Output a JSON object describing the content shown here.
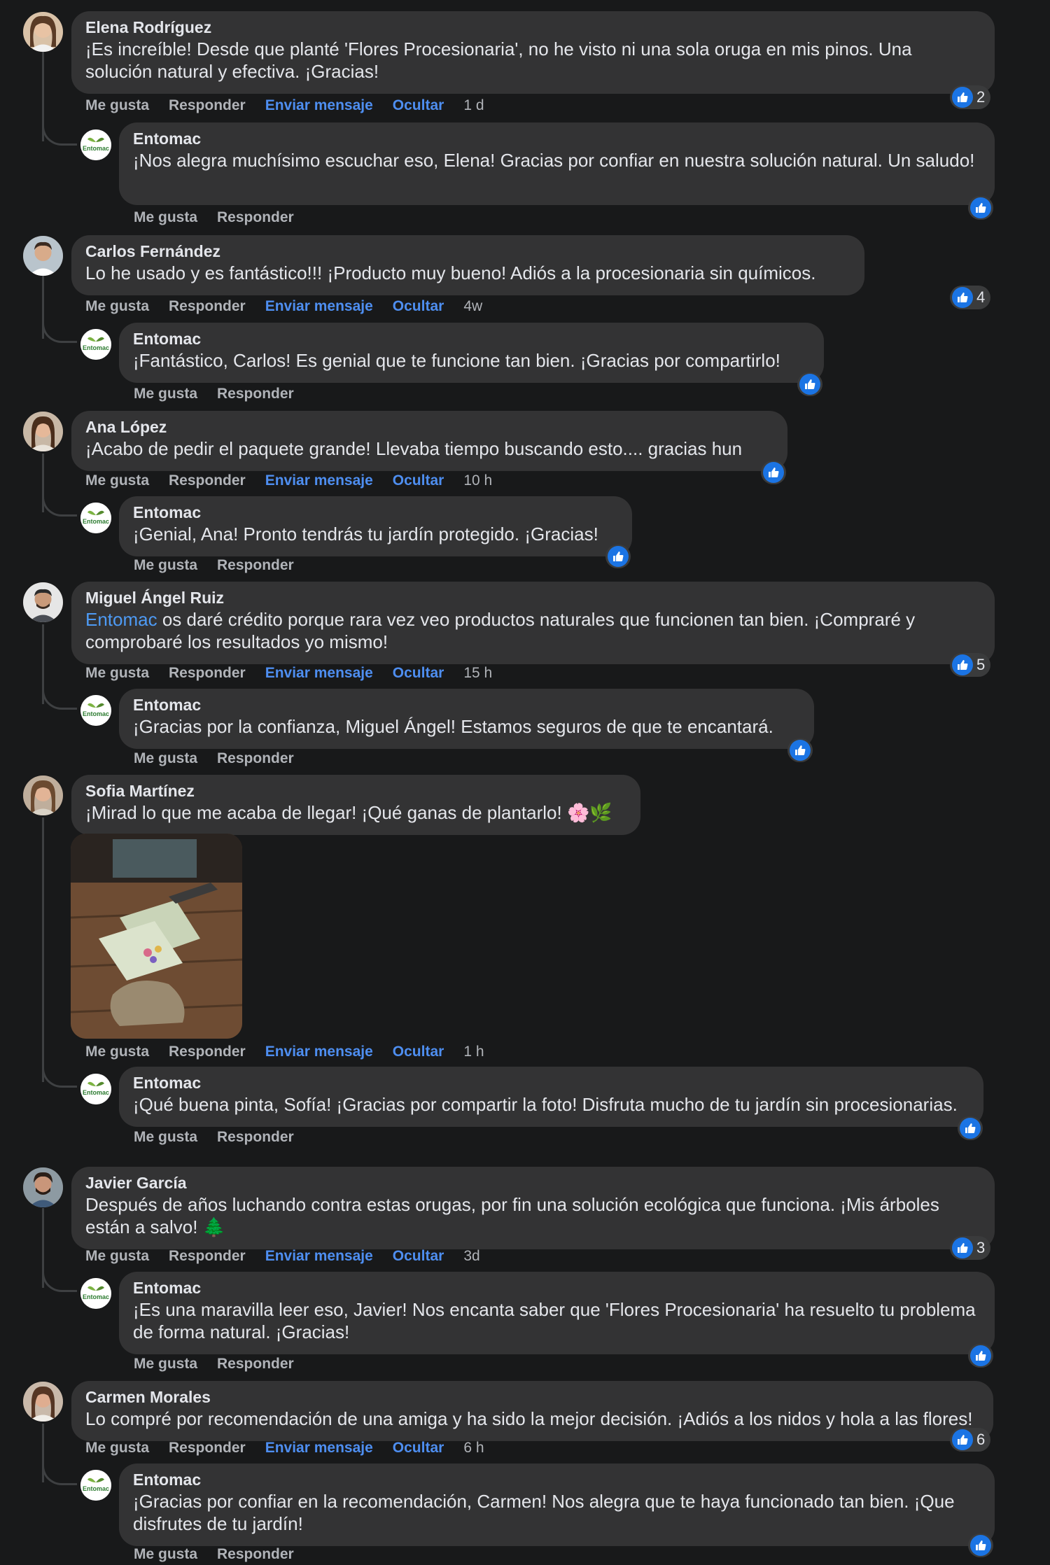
{
  "labels": {
    "like": "Me gusta",
    "reply": "Responder",
    "message": "Enviar mensaje",
    "hide": "Ocultar"
  },
  "comments": [
    {
      "author": "Elena Rodríguez",
      "text": "¡Es increíble! Desde que planté 'Flores Procesionaria', no he visto ni una sola oruga en mis pinos. Una solución natural y efectiva. ¡Gracias!",
      "time": "1 d",
      "likes": "2",
      "reply": {
        "author": "Entomac",
        "text": "¡Nos alegra muchísimo escuchar eso, Elena! Gracias por confiar en nuestra solución natural. Un saludo!"
      }
    },
    {
      "author": "Carlos Fernández",
      "text": "Lo he usado y es fantástico!!! ¡Producto muy bueno! Adiós a la procesionaria sin químicos.",
      "time": "4w",
      "likes": "4",
      "reply": {
        "author": "Entomac",
        "text": "¡Fantástico, Carlos! Es genial que te funcione tan bien. ¡Gracias por compartirlo!"
      }
    },
    {
      "author": "Ana López",
      "text": "¡Acabo de pedir el paquete grande! Llevaba tiempo buscando esto.... gracias hun",
      "time": "10 h",
      "likes": "",
      "reply": {
        "author": "Entomac",
        "text": "¡Genial, Ana! Pronto tendrás tu jardín protegido. ¡Gracias!"
      }
    },
    {
      "author": "Miguel Ángel Ruiz",
      "mention": "Entomac",
      "text": " os daré crédito porque rara vez veo productos naturales que funcionen tan bien. ¡Compraré y comprobaré los resultados yo mismo!",
      "time": "15 h",
      "likes": "5",
      "reply": {
        "author": "Entomac",
        "text": "¡Gracias por la confianza, Miguel Ángel! Estamos seguros de que te encantará."
      }
    },
    {
      "author": "Sofia Martínez",
      "text": "¡Mirad lo que me acaba de llegar! ¡Qué ganas de plantarlo! 🌸🌿",
      "time": "1 h",
      "likes": "",
      "reply": {
        "author": "Entomac",
        "text": "¡Qué buena pinta, Sofía! ¡Gracias por compartir la foto! Disfruta mucho de tu jardín sin procesionarias."
      }
    },
    {
      "author": "Javier García",
      "text": "Después de años luchando contra estas orugas, por fin una solución ecológica que funciona. ¡Mis árboles están a salvo! 🌲",
      "time": "3d",
      "likes": "3",
      "reply": {
        "author": "Entomac",
        "text": "¡Es una maravilla leer eso, Javier! Nos encanta saber que 'Flores Procesionaria' ha resuelto tu problema de forma natural. ¡Gracias!"
      }
    },
    {
      "author": "Carmen Morales",
      "text": "Lo compré por recomendación de una amiga y ha sido la mejor decisión. ¡Adiós a los nidos y hola a las flores!",
      "time": "6 h",
      "likes": "6",
      "reply": {
        "author": "Entomac",
        "text": "¡Gracias por confiar en la recomendación, Carmen! Nos alegra que te haya funcionado tan bien. ¡Que disfrutes de tu jardín!"
      }
    }
  ],
  "brand": {
    "logo_text": "Entomac",
    "accent": "#1b74e4",
    "link": "#4e8ef0"
  }
}
